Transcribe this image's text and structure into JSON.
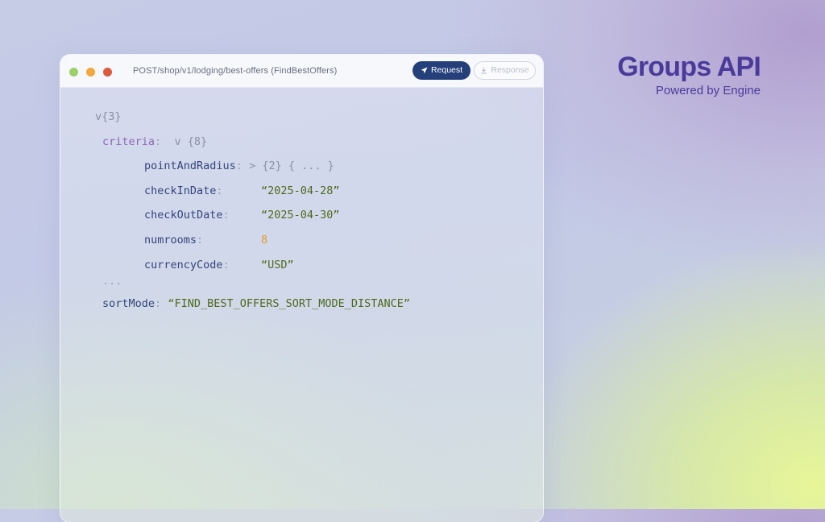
{
  "window": {
    "endpoint": "POST/shop/v1/lodging/best-offers (FindBestOffers)",
    "request_label": "Request",
    "response_label": "Response"
  },
  "code": {
    "root_toggle": "v",
    "root_count": "{3}",
    "criteria_key": "criteria",
    "criteria_toggle": "v",
    "criteria_count": "{8}",
    "point_key": "pointAndRadius",
    "point_toggle": ">",
    "point_count": "{2}",
    "point_collapsed": "{ ... }",
    "checkin_key": "checkInDate",
    "checkin_value": "“2025-04-28”",
    "checkout_key": "checkOutDate",
    "checkout_value": "“2025-04-30”",
    "numrooms_key": "numrooms",
    "numrooms_value": "8",
    "currency_key": "currencyCode",
    "currency_value": "“USD”",
    "ellipsis": "...",
    "sort_key": "sortMode",
    "sort_value": "“FIND_BEST_OFFERS_SORT_MODE_DISTANCE”",
    "colon": ":"
  },
  "brand": {
    "title": "Groups API",
    "subtitle": "Powered by Engine",
    "color": "#4a3b9a"
  },
  "colors": {
    "request_button": "#243f7a",
    "string": "#4d6a1c",
    "number": "#e59a2b",
    "key": "#33457a",
    "criteria_key": "#8c67b4"
  }
}
